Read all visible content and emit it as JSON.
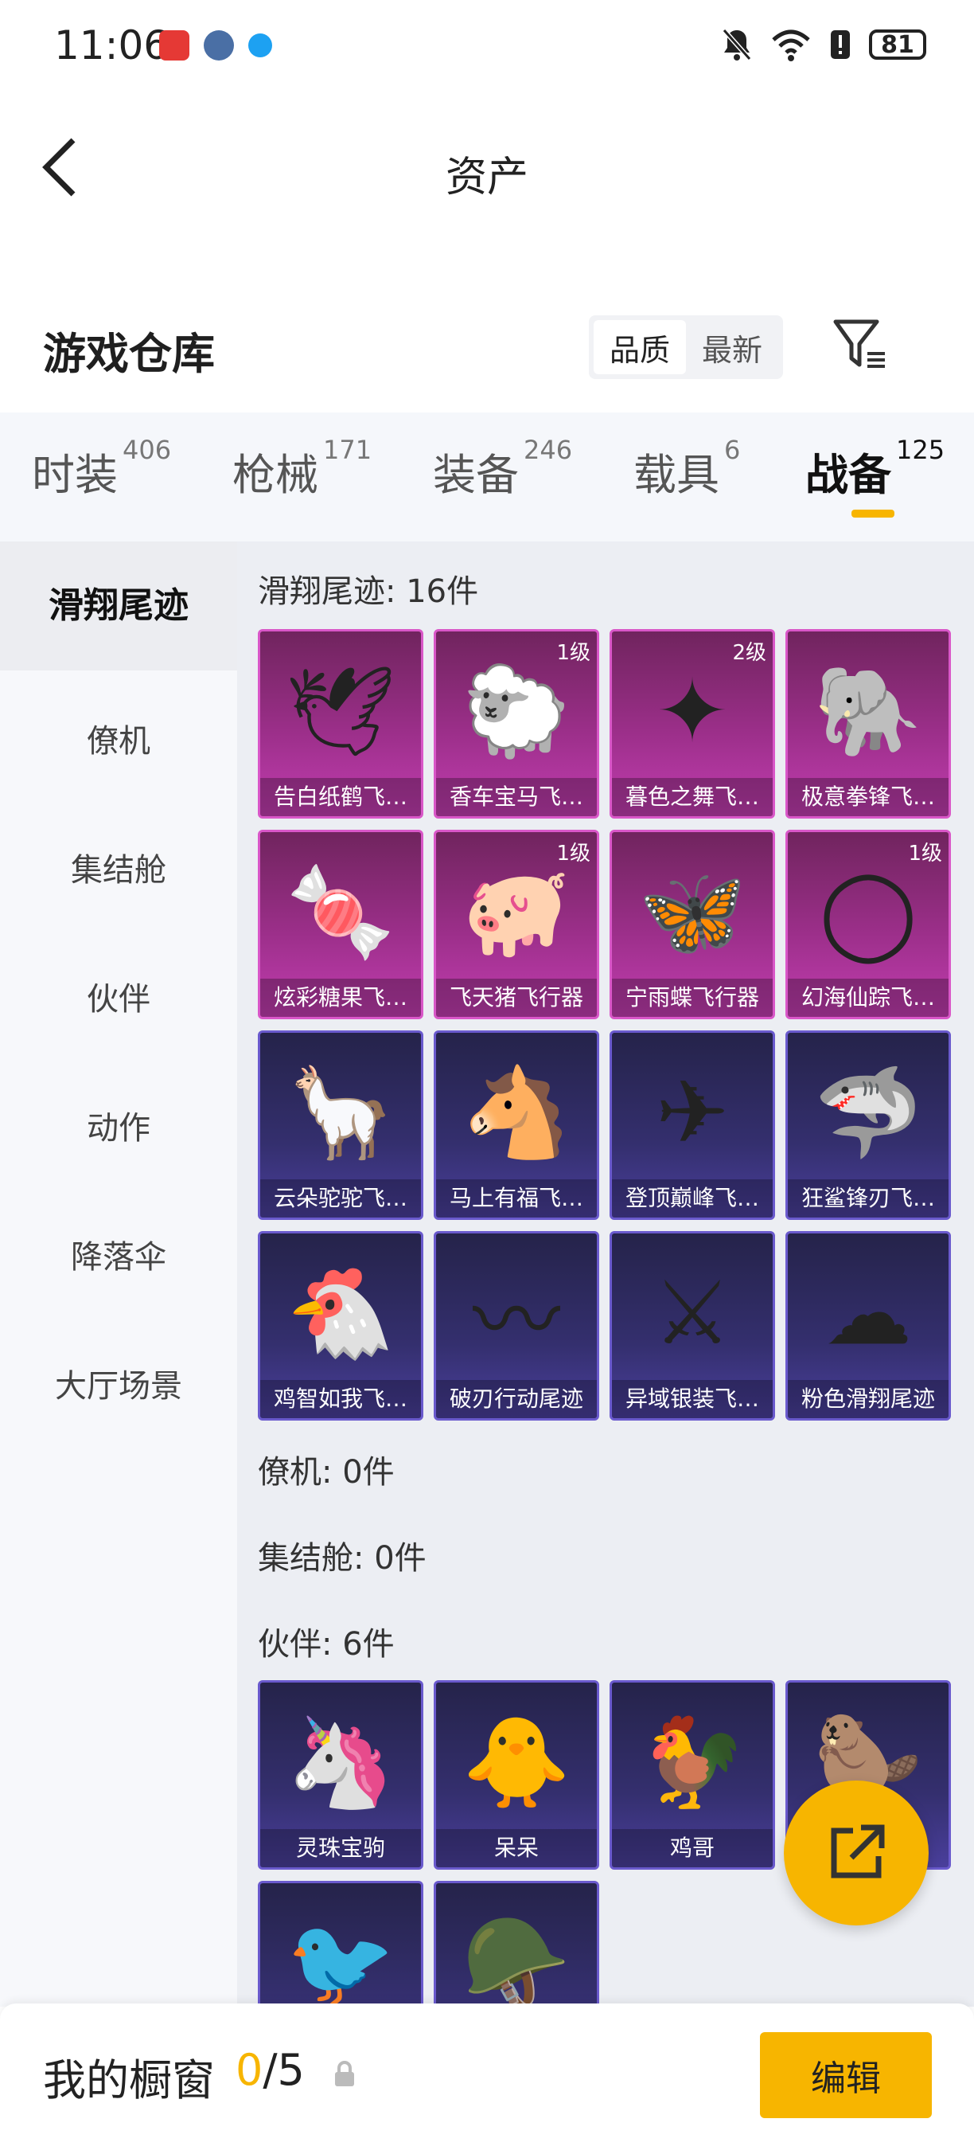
{
  "status_bar": {
    "time": "11:06",
    "battery": "81",
    "icons": [
      "huawei-app-icon",
      "globe-app-icon",
      "blue-app-icon",
      "mute-bell-icon",
      "wifi-icon",
      "alert-icon",
      "battery-icon"
    ]
  },
  "header": {
    "title": "资产"
  },
  "section": {
    "title": "游戏仓库",
    "sort_options": [
      "品质",
      "最新"
    ],
    "active_sort": "品质"
  },
  "categories": [
    {
      "label": "时装",
      "count": "406"
    },
    {
      "label": "枪械",
      "count": "171"
    },
    {
      "label": "装备",
      "count": "246"
    },
    {
      "label": "载具",
      "count": "6"
    },
    {
      "label": "战备",
      "count": "125"
    }
  ],
  "active_category": "战备",
  "sidebar": {
    "items": [
      "滑翔尾迹",
      "僚机",
      "集结舱",
      "伙伴",
      "动作",
      "降落伞",
      "大厅场景"
    ],
    "active": "滑翔尾迹"
  },
  "groups": {
    "glide": {
      "label": "滑翔尾迹: 16件",
      "items": [
        {
          "name": "告白纸鹤飞…",
          "level": "",
          "rarity": "purple",
          "icon": "paper-crane-icon"
        },
        {
          "name": "香车宝马飞…",
          "level": "1级",
          "rarity": "purple",
          "icon": "carriage-icon"
        },
        {
          "name": "暮色之舞飞…",
          "level": "2级",
          "rarity": "purple",
          "icon": "dance-icon"
        },
        {
          "name": "极意拳锋飞…",
          "level": "",
          "rarity": "purple",
          "icon": "elephant-icon"
        },
        {
          "name": "炫彩糖果飞…",
          "level": "",
          "rarity": "purple",
          "icon": "candy-icon"
        },
        {
          "name": "飞天猪飞行器",
          "level": "1级",
          "rarity": "purple",
          "icon": "pig-icon"
        },
        {
          "name": "宁雨蝶飞行器",
          "level": "",
          "rarity": "purple",
          "icon": "butterfly-icon"
        },
        {
          "name": "幻海仙踪飞…",
          "level": "1级",
          "rarity": "purple",
          "icon": "bubble-icon"
        },
        {
          "name": "云朵驼驼飞…",
          "level": "",
          "rarity": "blue",
          "icon": "alpaca-icon"
        },
        {
          "name": "马上有福飞…",
          "level": "",
          "rarity": "blue",
          "icon": "horse-icon"
        },
        {
          "name": "登顶巅峰飞…",
          "level": "",
          "rarity": "blue",
          "icon": "jet-icon"
        },
        {
          "name": "狂鲨锋刃飞…",
          "level": "",
          "rarity": "blue",
          "icon": "shark-icon"
        },
        {
          "name": "鸡智如我飞…",
          "level": "",
          "rarity": "blue",
          "icon": "chicken-icon"
        },
        {
          "name": "破刃行动尾迹",
          "level": "",
          "rarity": "blue",
          "icon": "trail-icon"
        },
        {
          "name": "异域银装飞…",
          "level": "",
          "rarity": "blue",
          "icon": "glider-icon"
        },
        {
          "name": "粉色滑翔尾迹",
          "level": "",
          "rarity": "blue",
          "icon": "smoke-trail-icon"
        }
      ]
    },
    "wingman": {
      "label": "僚机: 0件"
    },
    "pod": {
      "label": "集结舱: 0件"
    },
    "partner": {
      "label": "伙伴: 6件",
      "items": [
        {
          "name": "灵珠宝驹",
          "rarity": "blue",
          "icon": "pony-icon"
        },
        {
          "name": "呆呆",
          "rarity": "blue",
          "icon": "chick-icon"
        },
        {
          "name": "鸡哥",
          "rarity": "blue",
          "icon": "rooster-icon"
        },
        {
          "name": "",
          "rarity": "blue",
          "icon": "capybara-icon"
        },
        {
          "name": "",
          "rarity": "blue",
          "icon": "bird-icon"
        },
        {
          "name": "",
          "rarity": "blue",
          "icon": "helmet-chick-icon"
        }
      ]
    }
  },
  "bottom": {
    "title": "我的橱窗",
    "count_current": "0",
    "count_total": "/5",
    "edit_label": "编辑"
  },
  "colors": {
    "accent": "#f7b500",
    "purple_card": "#9c2f8a",
    "blue_card": "#342f6e"
  }
}
